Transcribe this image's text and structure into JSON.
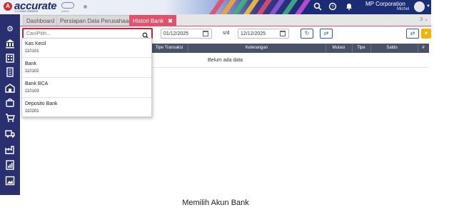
{
  "header": {
    "logo_text": "accurate",
    "logo_sub": "1-5-4563-2300599",
    "logo_online": "online",
    "company": "MP Corporation",
    "user": "Michel"
  },
  "tabs": [
    {
      "label": "Dashboard"
    },
    {
      "label": "Persiapan Data Perusahaan"
    },
    {
      "label": "Histori Bank",
      "active": true
    }
  ],
  "tab_close": "✖",
  "tab_count": "3 ⌄",
  "filters": {
    "search_placeholder": "Cari/Pilih...",
    "date_from": "01/12/2025",
    "date_separator": "s/d",
    "date_to": "12/12/2025"
  },
  "table": {
    "columns": [
      "Tipe Transaksi",
      "Keterangan",
      "Mutasi",
      "Tipe",
      "Saldo",
      "#"
    ],
    "empty_text": "Belum ada data"
  },
  "dropdown_items": [
    {
      "name": "Kas Kecil",
      "code": "110101"
    },
    {
      "name": "Bank",
      "code": "110102"
    },
    {
      "name": "Bank BCA",
      "code": "110103"
    },
    {
      "name": "Deposito Bank",
      "code": "110201"
    }
  ],
  "caption": "Memilih Akun Bank",
  "colors": {
    "sidebar": "#2a2f6f",
    "active_tab": "#e3506b",
    "table_header": "#4a5268",
    "highlight_border": "#cc2233",
    "accent_yellow": "#f4b400"
  }
}
